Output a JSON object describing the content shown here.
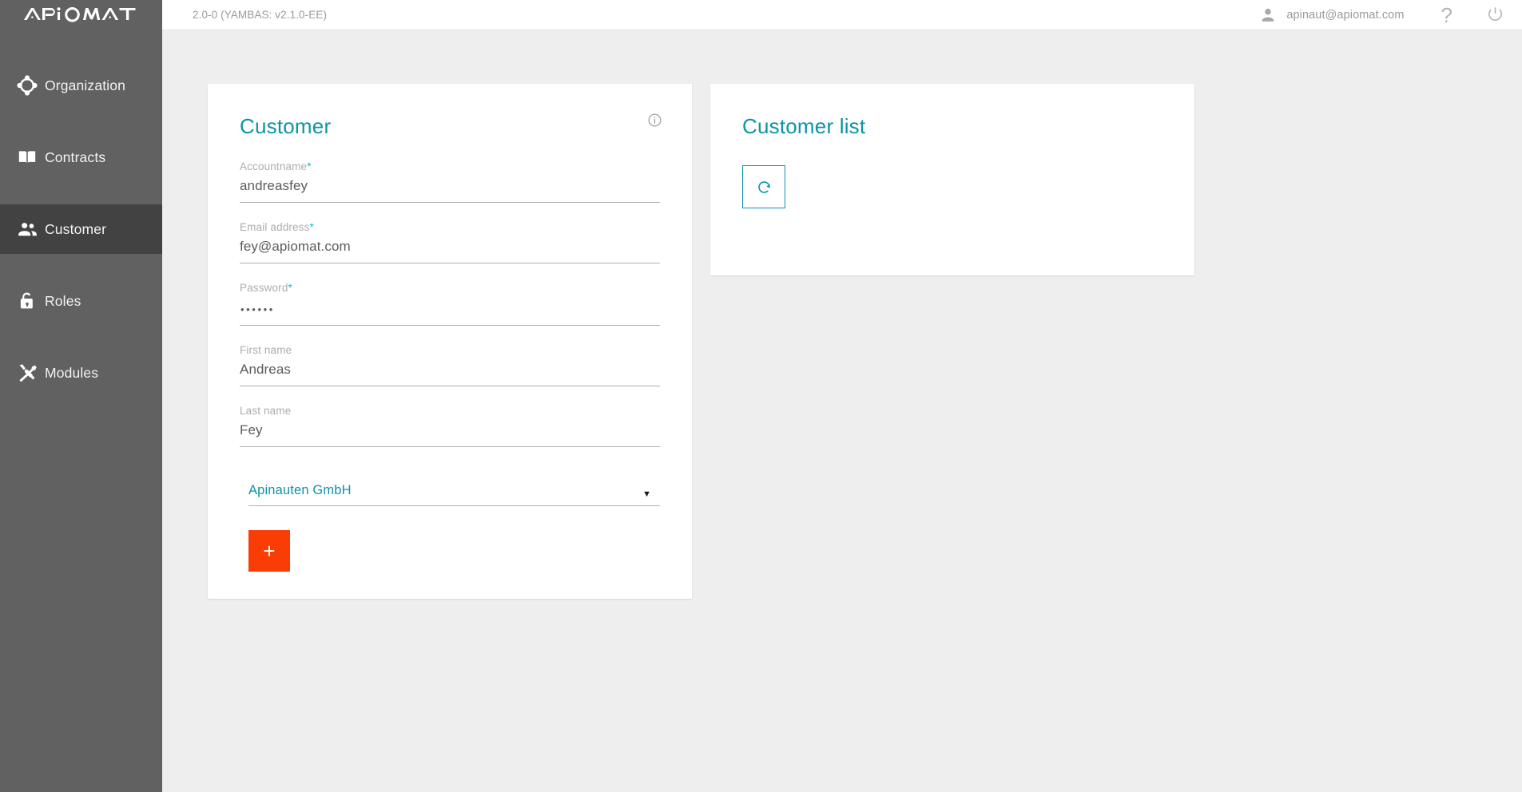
{
  "brand": {
    "logo_text": "APIOMAT",
    "accent_teal": "#0d93a8",
    "accent_orange": "#fa3c05",
    "sidebar_bg": "#616161",
    "sidebar_active_bg": "#424242",
    "page_bg": "#eeeeee"
  },
  "topbar": {
    "version": "2.0-0 (YAMBAS: v2.1.0-EE)",
    "user_email": "apinaut@apiomat.com",
    "help_label": "?",
    "user_icon": "person-icon",
    "help_icon": "question-mark-icon",
    "power_icon": "power-icon"
  },
  "sidebar": {
    "items": [
      {
        "label": "Organization",
        "icon": "hub-network-icon",
        "active": false
      },
      {
        "label": "Contracts",
        "icon": "open-book-icon",
        "active": false
      },
      {
        "label": "Customer",
        "icon": "people-group-icon",
        "active": true
      },
      {
        "label": "Roles",
        "icon": "unlocked-padlock-icon",
        "active": false
      },
      {
        "label": "Modules",
        "icon": "hammer-wrench-icon",
        "active": false
      }
    ]
  },
  "customer_card": {
    "title": "Customer",
    "info_icon": "info-circle-icon",
    "fields": [
      {
        "label": "Accountname",
        "required": true,
        "value": "andreasfey",
        "placeholder": "Accountname",
        "type": "text",
        "name": "accountname-field"
      },
      {
        "label": "Email address",
        "required": true,
        "value": "fey@apiomat.com",
        "placeholder": "Email address",
        "type": "email",
        "name": "email-field"
      },
      {
        "label": "Password",
        "required": true,
        "value": "••••••",
        "placeholder": "Password",
        "type": "password",
        "name": "password-field"
      },
      {
        "label": "First name",
        "required": false,
        "value": "Andreas",
        "placeholder": "First name",
        "type": "text",
        "name": "first-name-field"
      },
      {
        "label": "Last name",
        "required": false,
        "value": "Fey",
        "placeholder": "Last name",
        "type": "text",
        "name": "last-name-field"
      }
    ],
    "required_marker": "*",
    "organization_select": {
      "value": "Apinauten GmbH",
      "arrow": "▼",
      "options": [
        "Apinauten GmbH"
      ]
    },
    "add_button_label": "+"
  },
  "customer_list_card": {
    "title": "Customer list",
    "refresh_icon": "refresh-circular-arrow-icon",
    "rows": []
  }
}
